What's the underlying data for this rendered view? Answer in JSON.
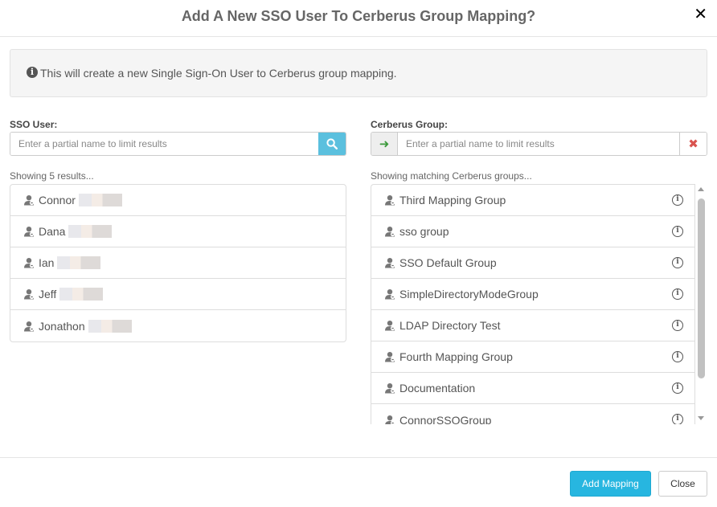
{
  "header": {
    "title": "Add A New SSO User To Cerberus Group Mapping?",
    "close_glyph": "✕"
  },
  "info": {
    "text": "This will create a new Single Sign-On User to Cerberus group mapping."
  },
  "sso": {
    "label": "SSO User:",
    "placeholder": "Enter a partial name to limit results",
    "results_label": "Showing 5 results...",
    "users": [
      {
        "name": "Connor"
      },
      {
        "name": "Dana"
      },
      {
        "name": "Ian"
      },
      {
        "name": "Jeff"
      },
      {
        "name": "Jonathon"
      }
    ]
  },
  "groups": {
    "label": "Cerberus Group:",
    "placeholder": "Enter a partial name to limit results",
    "results_label": "Showing matching Cerberus groups...",
    "items": [
      {
        "name": "Third Mapping Group"
      },
      {
        "name": "sso group"
      },
      {
        "name": "SSO Default Group"
      },
      {
        "name": "SimpleDirectoryModeGroup"
      },
      {
        "name": "LDAP Directory Test"
      },
      {
        "name": "Fourth Mapping Group"
      },
      {
        "name": "Documentation"
      },
      {
        "name": "ConnorSSOGroup"
      }
    ]
  },
  "footer": {
    "add_label": "Add Mapping",
    "close_label": "Close"
  },
  "colors": {
    "primary": "#27b6e0",
    "search_button": "#5bc0de",
    "arrow_green": "#3c9a3c",
    "clear_red": "#d9534f"
  },
  "icons": {
    "search": "search-icon",
    "arrow": "arrow-right-icon",
    "clear": "clear-icon",
    "user": "user-icon",
    "info": "info-icon"
  }
}
